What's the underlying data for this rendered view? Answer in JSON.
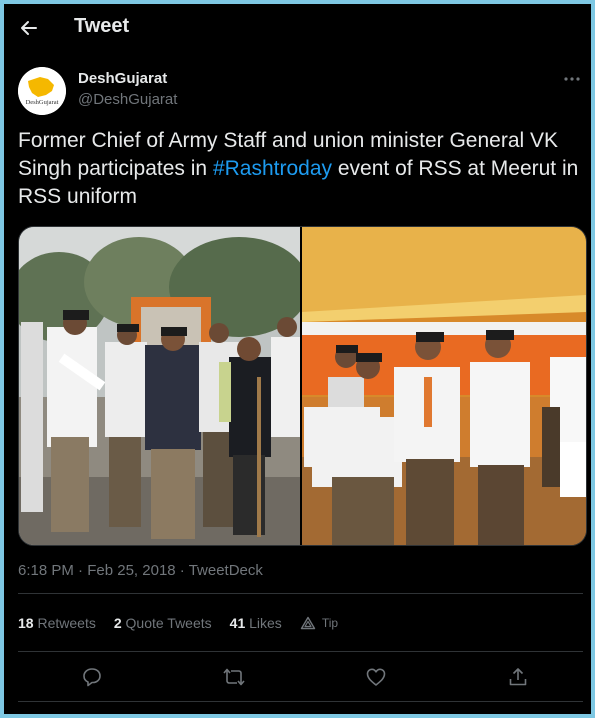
{
  "header": {
    "title": "Tweet"
  },
  "author": {
    "display_name": "DeshGujarat",
    "handle": "@DeshGujarat",
    "avatar_text": "DeshGujarat"
  },
  "tweet": {
    "text_before": "Former Chief of Army Staff and union minister General VK Singh participates in ",
    "hashtag": "#Rashtroday",
    "text_after": " event of RSS at Meerut in RSS uniform"
  },
  "photos": [
    {
      "name": "photo-left"
    },
    {
      "name": "photo-right"
    }
  ],
  "meta": {
    "time": "6:18 PM",
    "date": "Feb 25, 2018",
    "source": "TweetDeck",
    "separator": " · "
  },
  "stats": {
    "retweets_count": "18",
    "retweets_label": "Retweets",
    "quote_count": "2",
    "quote_label": "Quote Tweets",
    "likes_count": "41",
    "likes_label": "Likes",
    "tip_label": "Tip"
  },
  "colors": {
    "background": "#000000",
    "text": "#e7e9ea",
    "muted": "#71767b",
    "accent": "#1d9bf0",
    "border": "#2f3336"
  },
  "icons": [
    "back-arrow-icon",
    "more-icon",
    "tip-icon",
    "reply-icon",
    "retweet-icon",
    "like-icon",
    "share-icon"
  ]
}
